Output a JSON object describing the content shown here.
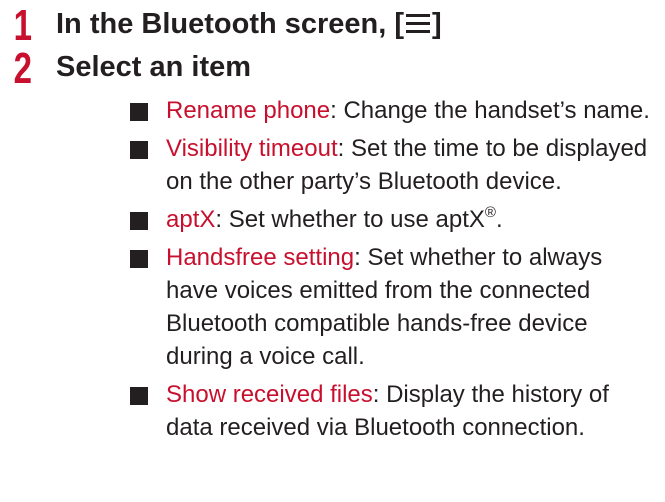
{
  "steps": [
    {
      "number": "1",
      "title_before": "In the Bluetooth screen, [",
      "title_after": "]",
      "icon": "menu-icon"
    },
    {
      "number": "2",
      "title": "Select an item"
    }
  ],
  "items": [
    {
      "term": "Rename phone",
      "desc": ": Change the handset’s name."
    },
    {
      "term": "Visibility timeout",
      "desc": ": Set the time to be displayed on the other party’s Bluetooth device."
    },
    {
      "term": "aptX",
      "desc": ": Set whether to use aptX",
      "sup": "®",
      "desc_after": "."
    },
    {
      "term": "Handsfree setting",
      "desc": ": Set whether to always have voices emitted from the connected Bluetooth compatible hands-free device during a voice call."
    },
    {
      "term": "Show received files",
      "desc": ": Display the history of data received via Bluetooth connection."
    }
  ],
  "colors": {
    "accent": "#c8102e",
    "text": "#231f20"
  }
}
